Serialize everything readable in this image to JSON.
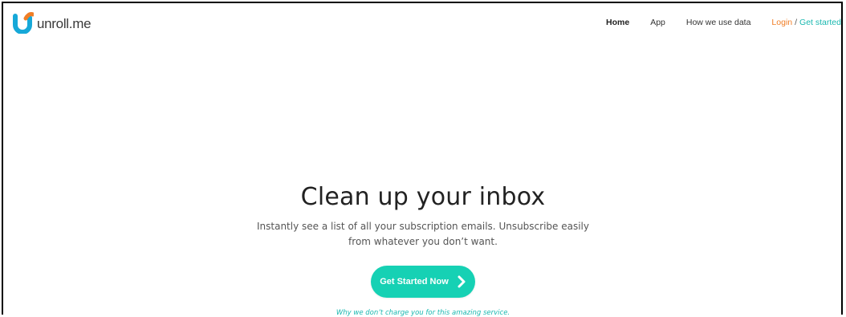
{
  "brand": {
    "name": "unroll.me",
    "logo_colors": {
      "primary": "#16a8d8",
      "accent": "#f07e26"
    }
  },
  "nav": {
    "items": [
      "Home",
      "App",
      "How we use data"
    ],
    "login": "Login",
    "separator": "/",
    "get_started": "Get started"
  },
  "hero": {
    "title": "Clean up your inbox",
    "subtitle": "Instantly see a list of all your subscription emails. Unsubscribe easily from whatever you don’t want.",
    "cta_label": "Get Started Now",
    "cta_icon": "chevron-right-icon",
    "why_link": "Why we don’t charge you for this amazing service."
  },
  "colors": {
    "cta": "#16d1b4",
    "login": "#f07e26",
    "link": "#1ab8b0"
  }
}
